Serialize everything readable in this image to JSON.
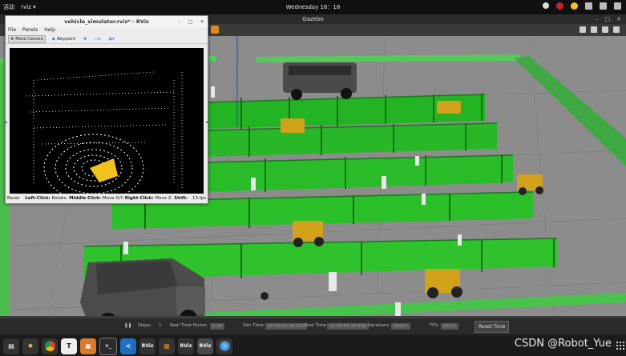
{
  "topbar": {
    "activities": "活动",
    "app_menu": "rviz ▾",
    "clock": "Wednesday 16：18"
  },
  "gazebo": {
    "title": "Gazebo",
    "status": {
      "steps_label": "Steps:",
      "steps_value": "1",
      "rtf_label": "Real Time Factor:",
      "rtf_value": "0.20",
      "sim_time_label": "Sim Time",
      "sim_time_value": "00 00:10:04.292",
      "real_time_label": "Real Time",
      "real_time_value": "00 00:51:19.938",
      "iterations_label": "Iterations",
      "iterations_value": "29417",
      "fps_label": "FPS:",
      "fps_value": "58.21",
      "reset_label": "Reset Time"
    },
    "colors": {
      "ground": "#8a8a8a",
      "wall": "#49c24b",
      "vine": "#1fb81f",
      "post": "#1e8a1e",
      "tractor": "#d6a51c"
    }
  },
  "rviz": {
    "title": "vehicle_simulator.rviz* - RViz",
    "menu": {
      "file": "File",
      "panels": "Panels",
      "help": "Help"
    },
    "tools": {
      "move_camera": "Move Camera",
      "waypoint": "Waypoint"
    },
    "footer": {
      "reset": "Reset",
      "left_click": "Left-Click:",
      "left_action": " Rotate.",
      "middle_click": "Middle-Click:",
      "middle_action": " Move X/Y.",
      "right_click": "Right-Click:",
      "right_action": " Move Z.",
      "shift": "Shift:",
      "fps": "13 fps"
    }
  },
  "taskbar": {
    "apps": [
      "show-apps",
      "settings",
      "chrome",
      "typora",
      "files",
      "terminal",
      "vscode",
      "rviz",
      "layers",
      "rviz",
      "rviz",
      "globe"
    ],
    "rviz_label": "RViz",
    "terminal_label": ">_"
  },
  "watermark": "CSDN @Robot_Yue"
}
